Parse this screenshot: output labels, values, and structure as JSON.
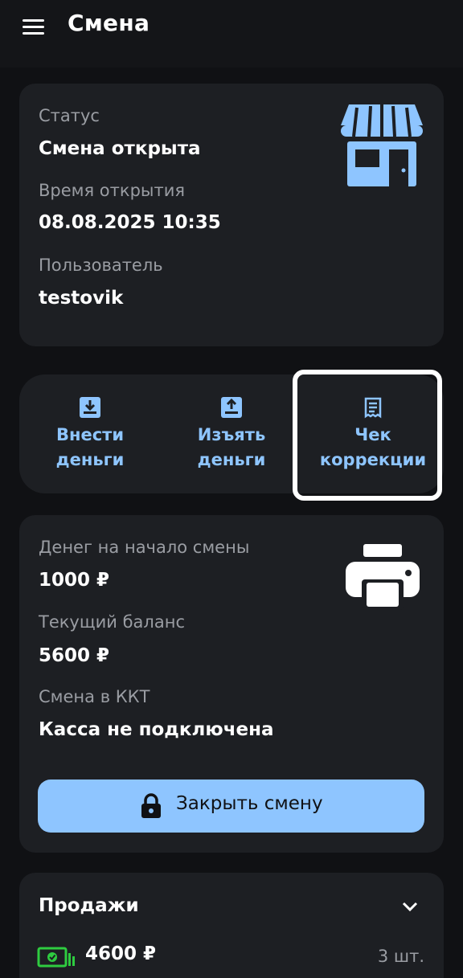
{
  "header": {
    "title": "Смена"
  },
  "status_card": {
    "status_label": "Статус",
    "status_value": "Смена открыта",
    "open_time_label": "Время открытия",
    "open_time_value": "08.08.2025 10:35",
    "user_label": "Пользователь",
    "user_value": "testovik",
    "icon": "store-icon"
  },
  "actions": [
    {
      "line1": "Внести",
      "line2": "деньги",
      "icon": "deposit-icon"
    },
    {
      "line1": "Изъять",
      "line2": "деньги",
      "icon": "withdraw-icon"
    },
    {
      "line1": "Чек",
      "line2": "коррекции",
      "icon": "receipt-icon"
    }
  ],
  "balance_card": {
    "start_label": "Денег на начало смены",
    "start_value": "1000 ₽",
    "current_label": "Текущий баланс",
    "current_value": "5600 ₽",
    "kkt_label": "Смена в ККТ",
    "kkt_value": "Касса не подключена",
    "icon": "printer-icon",
    "close_button": "Закрыть смену"
  },
  "sales": {
    "title": "Продажи",
    "amount": "4600 ₽",
    "count": "3 шт."
  },
  "colors": {
    "background": "#101114",
    "card": "#1d1f23",
    "accent": "#8ec5ff",
    "money_green": "#2ecc40",
    "muted_text": "#9a9da3"
  }
}
